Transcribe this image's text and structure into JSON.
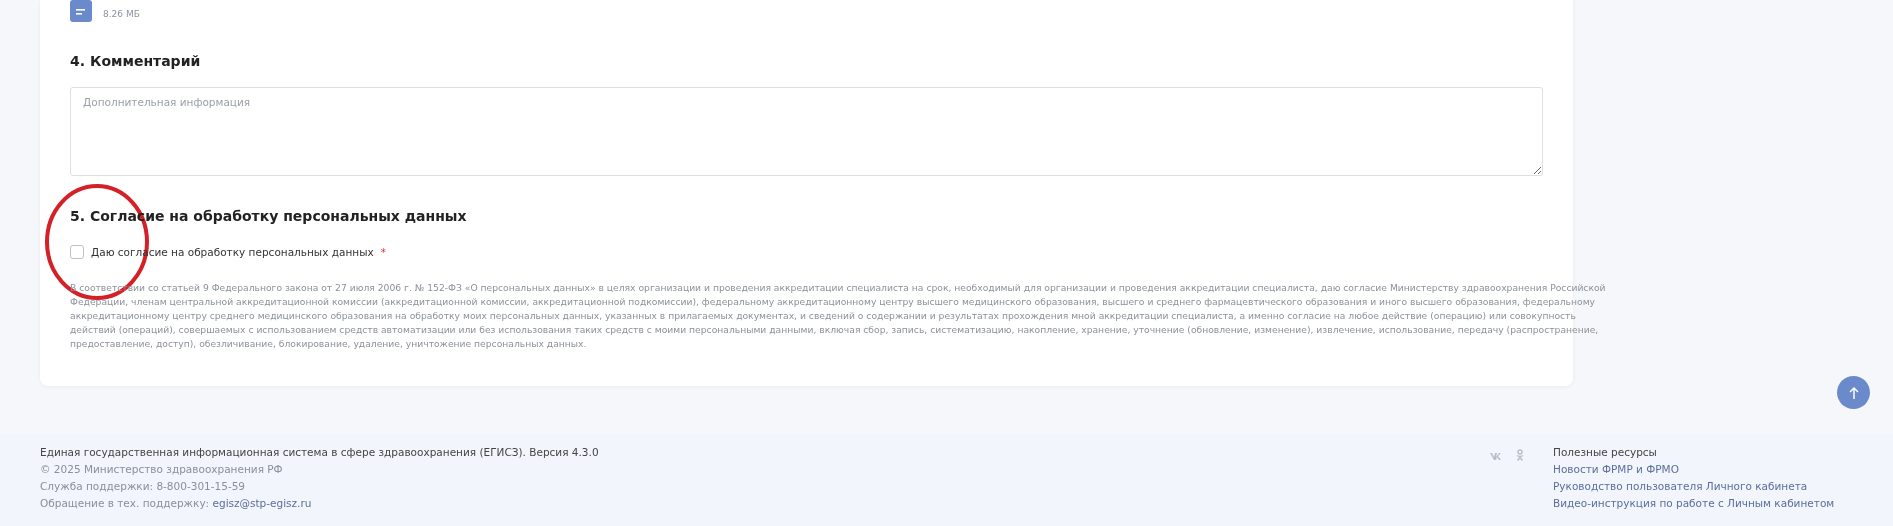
{
  "attachment": {
    "size": "8.26 МБ"
  },
  "comment": {
    "title": "4. Комментарий",
    "placeholder": "Дополнительная информация"
  },
  "consent": {
    "title": "5. Согласие на обработку персональных данных",
    "checkbox": {
      "label": "Даю согласие на обработку персональных данных",
      "required_mark": "*",
      "checked": false
    },
    "text": "В соответствии со статьей 9 Федерального закона от 27 июля 2006 г. № 152-ФЗ «О персональных данных» в целях организации и проведения аккредитации специалиста на срок, необходимый для организации и проведения аккредитации специалиста, даю согласие Министерству здравоохранения Российской Федерации, членам центральной аккредитационной комиссии (аккредитационной комиссии, аккредитационной подкомиссии), федеральному аккредитационному центру высшего медицинского образования, высшего и среднего фармацевтического образования и иного высшего образования, федеральному аккредитационному центру среднего медицинского образования на обработку моих персональных данных, указанных в прилагаемых документах, и сведений о содержании и результатах прохождения мной аккредитации специалиста, а именно согласие на любое действие (операцию) или совокупность действий (операций), совершаемых с использованием средств автоматизации или без использования таких средств с моими персональными данными, включая сбор, запись, систематизацию, накопление, хранение, уточнение (обновление, изменение), извлечение, использование, передачу (распространение, предоставление, доступ), обезличивание, блокирование, удаление, уничтожение персональных данных."
  },
  "footer": {
    "title": "Единая государственная информационная система в сфере здравоохранения (ЕГИСЗ). Версия 4.3.0",
    "copyright": "© 2025 Министерство здравоохранения РФ",
    "phone": "Служба поддержки: 8-800-301-15-59",
    "support_label": "Обращение в тех. поддержку: ",
    "support_email": "egisz@stp-egisz.ru",
    "resources": {
      "title": "Полезные ресурсы",
      "links": [
        "Новости ФРМР и ФРМО",
        "Руководство пользователя Личного кабинета",
        "Видео-инструкция по работе с Личным кабинетом"
      ]
    }
  }
}
